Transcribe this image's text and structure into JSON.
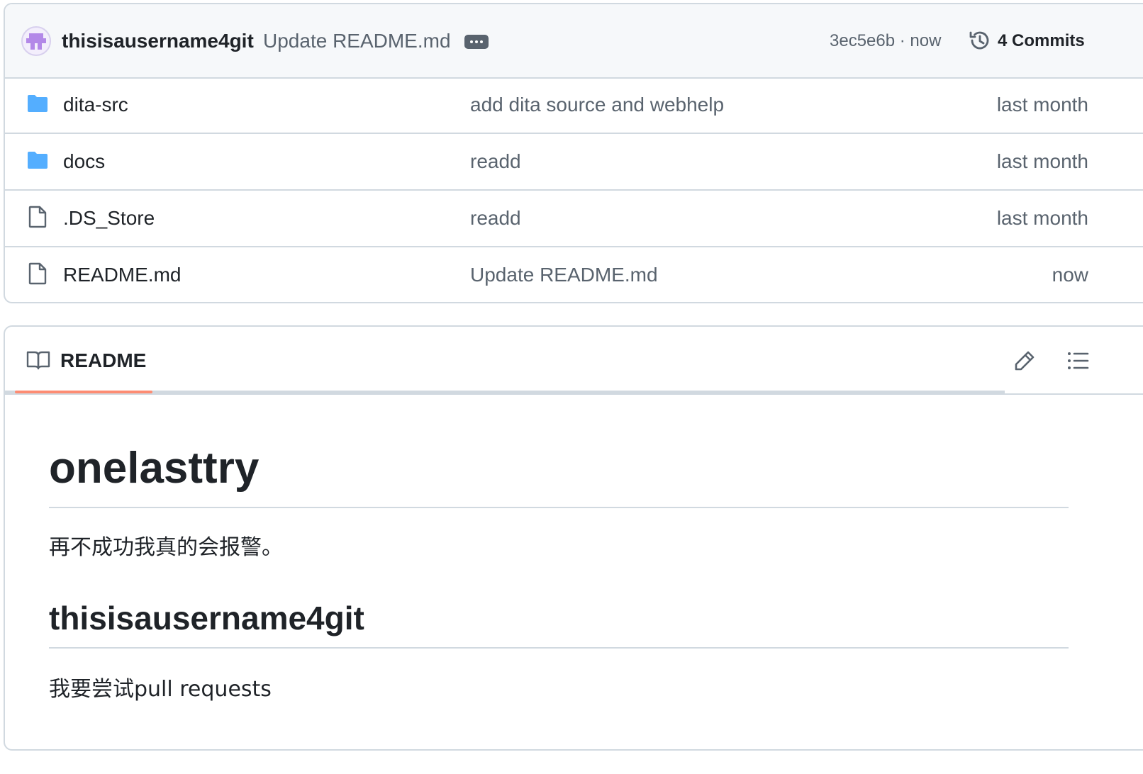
{
  "commit": {
    "author": "thisisausername4git",
    "message": "Update README.md",
    "sha_time": "3ec5e6b · now",
    "commit_count": "4 Commits"
  },
  "files": [
    {
      "name": "dita-src",
      "type": "folder",
      "commit": "add dita source and webhelp",
      "date": "last month"
    },
    {
      "name": "docs",
      "type": "folder",
      "commit": "readd",
      "date": "last month"
    },
    {
      "name": ".DS_Store",
      "type": "file",
      "commit": "readd",
      "date": "last month"
    },
    {
      "name": "README.md",
      "type": "file",
      "commit": "Update README.md",
      "date": "now"
    }
  ],
  "readme": {
    "tab_label": "README",
    "h1": "onelasttry",
    "p1": "再不成功我真的会报警。",
    "h2": "thisisausername4git",
    "p2": "我要尝试pull requests"
  },
  "icons": {
    "folder": "folder-icon",
    "file": "file-icon",
    "history": "history-icon",
    "book": "book-icon",
    "edit": "pencil-icon",
    "toc": "list-icon",
    "ellipsis": "ellipsis-icon"
  },
  "colors": {
    "folder": "#54aeff",
    "tab_underline": "#fd8c73",
    "muted_text": "#59636e",
    "border": "#d1d9e0"
  }
}
